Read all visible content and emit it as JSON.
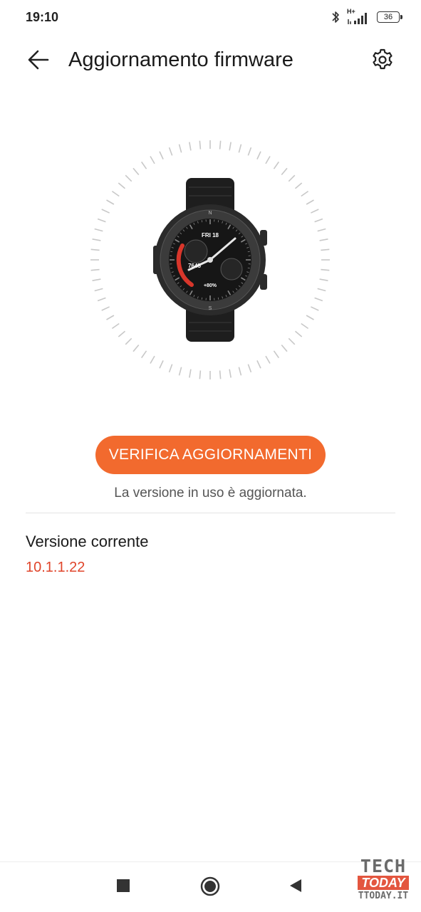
{
  "status_bar": {
    "time": "19:10",
    "network": "H+",
    "battery": "36"
  },
  "header": {
    "title": "Aggiornamento firmware"
  },
  "watch": {
    "date_label": "FRI 18",
    "steps": "7645",
    "battery_text": "+80%"
  },
  "update": {
    "check_button_label": "VERIFICA AGGIORNAMENTI",
    "status_message": "La versione in uso è aggiornata."
  },
  "version": {
    "label": "Versione corrente",
    "value": "10.1.1.22"
  },
  "watermark": {
    "line1": "TECH",
    "line2": "TODAY",
    "line3": "TTODAY.IT"
  },
  "colors": {
    "accent": "#f26a2e",
    "version_text": "#e0452b"
  },
  "icons": {
    "back": "arrow-left-icon",
    "settings": "gear-icon",
    "nav_recents": "square-icon",
    "nav_home": "circle-icon",
    "nav_back": "triangle-left-icon"
  }
}
